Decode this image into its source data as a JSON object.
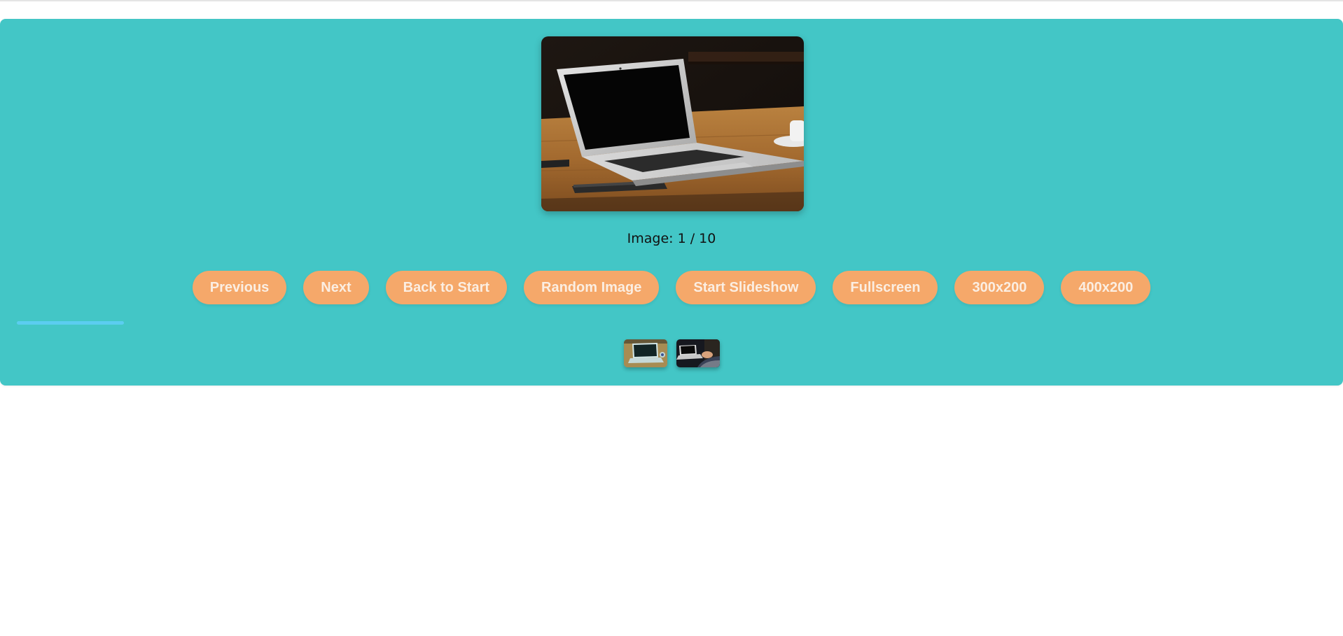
{
  "gallery": {
    "image_alt": "Laptop on a wooden table",
    "counter_text": "Image: 1 / 10",
    "current_index": 1,
    "total_images": 10,
    "progress_fraction": 0.082,
    "thumbnails": [
      {
        "alt": "Laptop on wooden table thumbnail",
        "active": true
      },
      {
        "alt": "Person using laptop thumbnail",
        "active": false
      }
    ]
  },
  "controls": {
    "previous_label": "Previous",
    "next_label": "Next",
    "back_to_start_label": "Back to Start",
    "random_label": "Random Image",
    "slideshow_label": "Start Slideshow",
    "fullscreen_label": "Fullscreen",
    "size_300_label": "300x200",
    "size_400_label": "400x200"
  },
  "colors": {
    "panel": "#43c6c6",
    "button": "#f5a86a",
    "button_text": "#fbeee2",
    "progress": "#5bcdf0"
  }
}
